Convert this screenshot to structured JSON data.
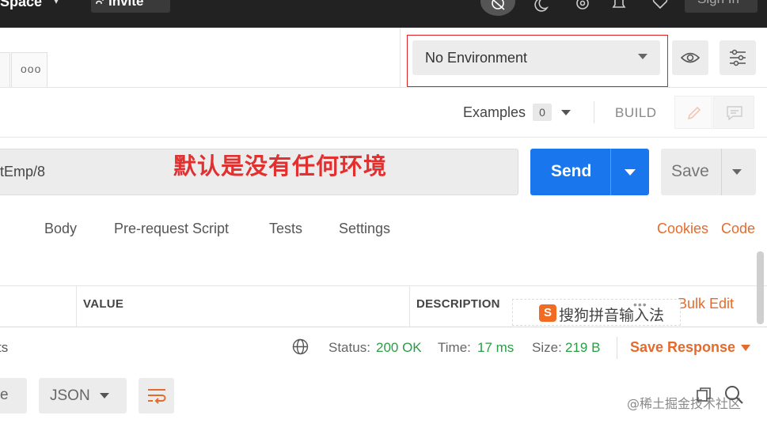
{
  "topbar": {
    "workspace_label": "Space",
    "invite_label": "Invite",
    "signin_label": "Sign In"
  },
  "tabs": {
    "more_label": "ooo"
  },
  "environment": {
    "selected": "No Environment"
  },
  "examples": {
    "label": "Examples",
    "count": "0",
    "build_label": "BUILD"
  },
  "request": {
    "url_fragment": "tEmp/8",
    "annotation": "默认是没有任何环境",
    "send_label": "Send",
    "save_label": "Save"
  },
  "request_tabs": {
    "paren_fragment": ")",
    "items": [
      "Body",
      "Pre-request Script",
      "Tests",
      "Settings"
    ],
    "cookies_label": "Cookies",
    "code_label": "Code"
  },
  "params_table": {
    "headers": [
      "VALUE",
      "DESCRIPTION"
    ],
    "bulk_edit_label": "Bulk Edit"
  },
  "ime": {
    "text": "搜狗拼音输入法",
    "logo": "S",
    "dots": "•••"
  },
  "response": {
    "tab_fragment": "ts",
    "status_label": "Status:",
    "status_value": "200 OK",
    "time_label": "Time:",
    "time_value": "17 ms",
    "size_label": "Size:",
    "size_value": "219 B",
    "save_response_label": "Save Response"
  },
  "bottom": {
    "pretty_fragment": "e",
    "format_label": "JSON",
    "watermark": "@稀土掘金技术社区"
  },
  "colors": {
    "accent_orange": "#e66a2c",
    "send_blue": "#1a76ed",
    "status_green": "#2a9d44",
    "annotation_red": "#e03030"
  }
}
